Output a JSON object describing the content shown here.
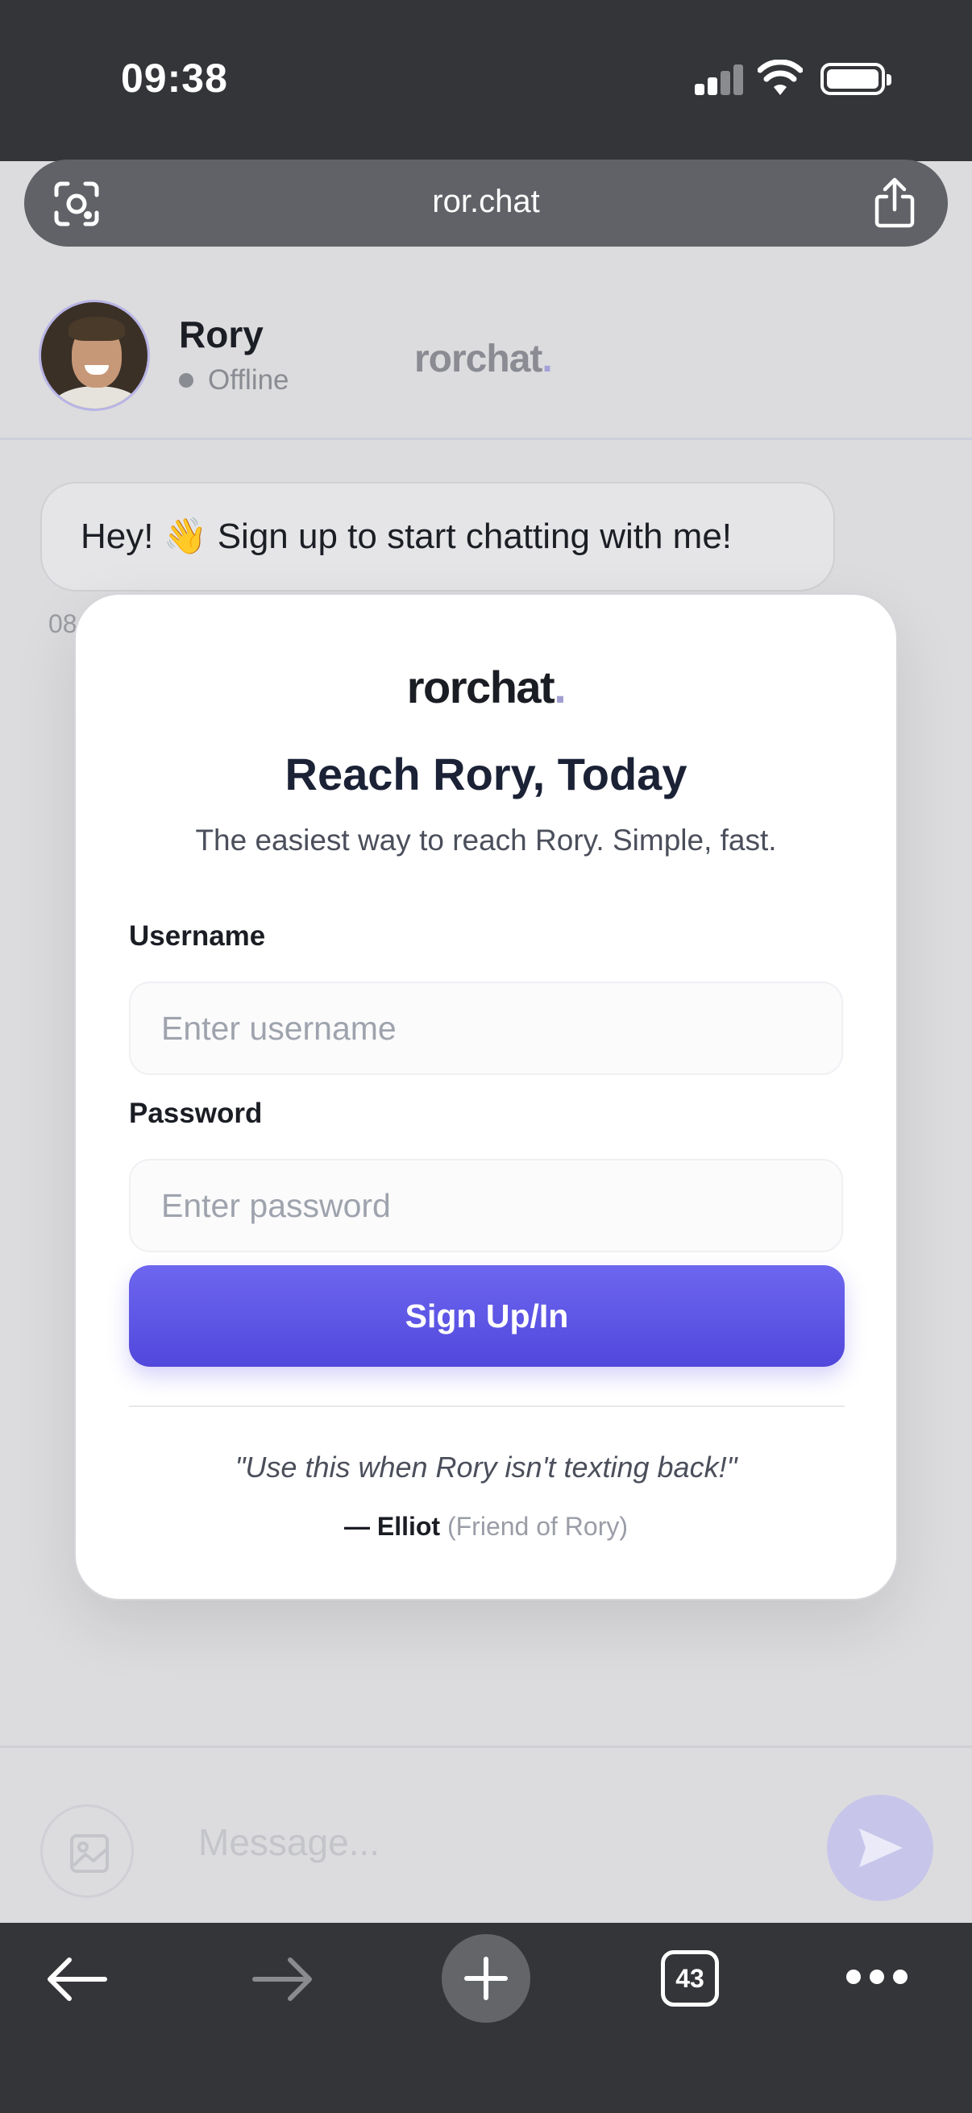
{
  "status_bar": {
    "time": "09:38"
  },
  "browser": {
    "url": "ror.chat",
    "tabs_count": "43"
  },
  "chat": {
    "contact_name": "Rory",
    "contact_status": "Offline",
    "header_logo": "rorchat",
    "header_logo_dot": ".",
    "message_text": "Hey! 👋 Sign up to start chatting with me!",
    "message_time": "08",
    "composer_placeholder": "Message..."
  },
  "modal": {
    "logo": "rorchat",
    "logo_dot": ".",
    "title": "Reach Rory, Today",
    "subtitle": "The easiest way to reach Rory. Simple, fast.",
    "username_label": "Username",
    "username_placeholder": "Enter username",
    "password_label": "Password",
    "password_placeholder": "Enter password",
    "submit_label": "Sign Up/In",
    "quote": "\"Use this when Rory isn't texting back!\"",
    "quote_author": "— Elliot",
    "quote_role": "(Friend of Rory)"
  },
  "colors": {
    "accent": "#5b53e6",
    "chrome": "#343538",
    "overlay_page": "#dcdcde"
  },
  "icons": [
    "lens-icon",
    "share-icon",
    "image-icon",
    "send-icon",
    "back-arrow-icon",
    "forward-arrow-icon",
    "plus-icon",
    "more-icon"
  ]
}
